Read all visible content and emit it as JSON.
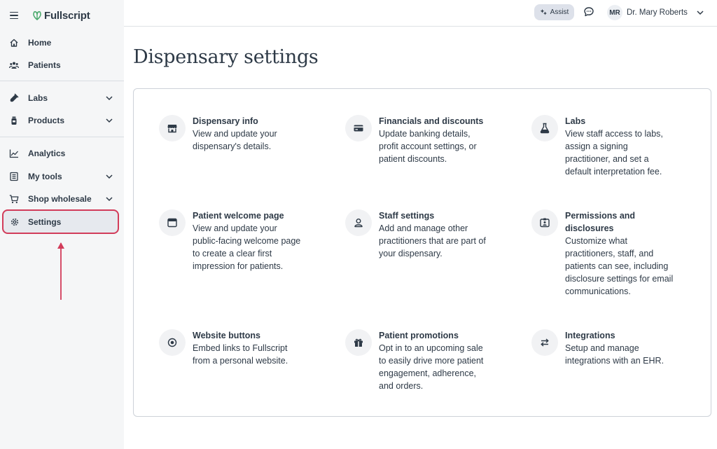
{
  "brand": {
    "name": "Fullscript"
  },
  "sidebar": {
    "items": [
      {
        "label": "Home",
        "icon": "home-icon"
      },
      {
        "label": "Patients",
        "icon": "patients-icon"
      },
      {
        "label": "Labs",
        "icon": "labs-icon",
        "expandable": true
      },
      {
        "label": "Products",
        "icon": "products-icon",
        "expandable": true
      },
      {
        "label": "Analytics",
        "icon": "analytics-icon"
      },
      {
        "label": "My tools",
        "icon": "tools-icon",
        "expandable": true
      },
      {
        "label": "Shop wholesale",
        "icon": "cart-icon",
        "expandable": true
      },
      {
        "label": "Settings",
        "icon": "gear-icon",
        "active": true
      }
    ]
  },
  "header": {
    "assist_label": "Assist",
    "user_initials": "MR",
    "user_name": "Dr. Mary Roberts"
  },
  "main": {
    "title": "Dispensary settings",
    "settings": [
      {
        "title": "Dispensary info",
        "desc": [
          "View and update your",
          "dispensary's details."
        ],
        "icon": "storefront-icon"
      },
      {
        "title": "Financials and discounts",
        "desc": [
          "Update banking details,",
          "profit account settings, or",
          "patient discounts."
        ],
        "icon": "credit-card-icon"
      },
      {
        "title": "Labs",
        "desc": [
          "View staff access to labs,",
          "assign a signing",
          "practitioner, and set a",
          "default interpretation fee."
        ],
        "icon": "flask-icon"
      },
      {
        "title": "Patient welcome page",
        "desc": [
          "View and update your",
          "public-facing welcome page",
          "to create a clear first",
          "impression for patients."
        ],
        "icon": "browser-window-icon"
      },
      {
        "title": "Staff settings",
        "desc": [
          "Add and manage other",
          "practitioners that are part of",
          "your dispensary."
        ],
        "icon": "person-icon"
      },
      {
        "title": "Permissions and",
        "title2": "disclosures",
        "desc": [
          "Customize what",
          "practitioners, staff, and",
          "patients can see, including",
          "disclosure settings for email",
          "communications."
        ],
        "icon": "id-badge-icon"
      },
      {
        "title": "Website buttons",
        "desc": [
          "Embed links to Fullscript",
          "from a personal website."
        ],
        "icon": "target-icon"
      },
      {
        "title": "Patient promotions",
        "desc": [
          "Opt in to an upcoming sale",
          "to easily drive more patient",
          "engagement, adherence,",
          "and orders."
        ],
        "icon": "gift-icon"
      },
      {
        "title": "Integrations",
        "desc": [
          "Setup and manage",
          "integrations with an EHR."
        ],
        "icon": "swap-arrows-icon"
      }
    ]
  },
  "colors": {
    "highlight": "#d23c5a",
    "brand_green": "#4aa96c",
    "text": "#2e3a47"
  }
}
